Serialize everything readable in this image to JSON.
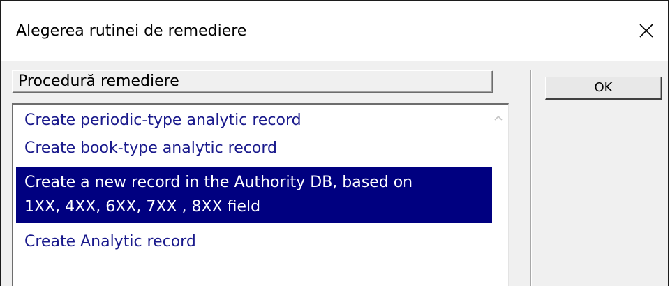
{
  "window": {
    "title": "Alegerea rutinei de remediere"
  },
  "list": {
    "column_header": "Procedură remediere",
    "items": [
      {
        "label": "Create periodic-type analytic record"
      },
      {
        "label": "Create book-type analytic record"
      },
      {
        "label": "Create a new record in the Authority DB, based on",
        "label_line2": "1XX, 4XX, 6XX, 7XX , 8XX field"
      },
      {
        "label": "Create Analytic record"
      }
    ],
    "selected_index": 2
  },
  "buttons": {
    "ok_label": "OK"
  },
  "colors": {
    "selection_bg": "#000080",
    "item_text": "#1a1a8c",
    "dialog_bg": "#f0f0f0"
  },
  "icons": {
    "close": "close-icon",
    "scroll_up": "chevron-up-icon"
  }
}
